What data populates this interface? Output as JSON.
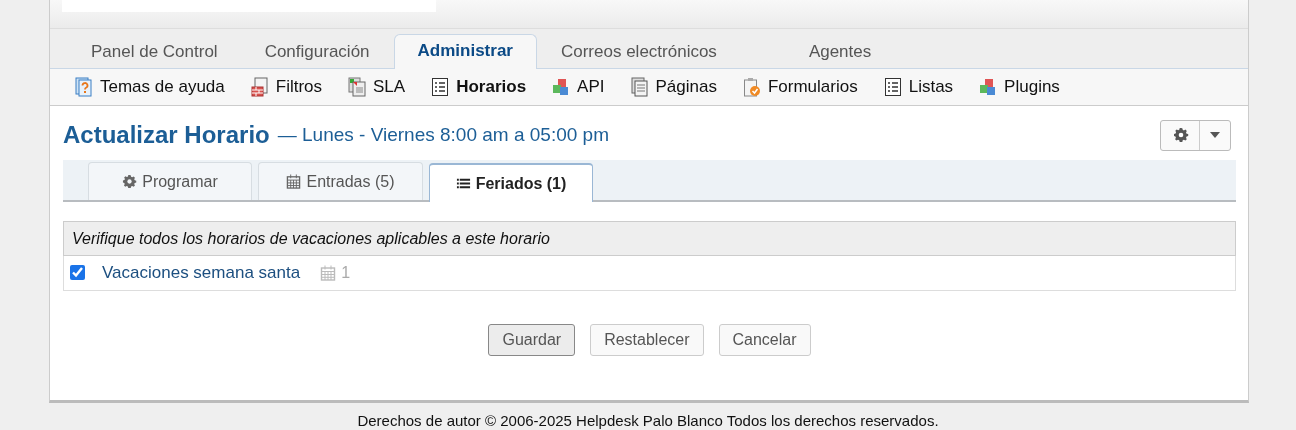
{
  "nav_tabs": [
    {
      "label": "Panel de Control",
      "selected": false
    },
    {
      "label": "Configuración",
      "selected": false
    },
    {
      "label": "Administrar",
      "selected": true
    },
    {
      "label": "Correos electrónicos",
      "selected": false
    },
    {
      "label": "Agentes",
      "selected": false
    }
  ],
  "subnav": [
    {
      "label": "Temas de ayuda",
      "kind": "help",
      "selected": false
    },
    {
      "label": "Filtros",
      "kind": "filter",
      "selected": false
    },
    {
      "label": "SLA",
      "kind": "sla",
      "selected": false
    },
    {
      "label": "Horarios",
      "kind": "list",
      "selected": true
    },
    {
      "label": "API",
      "kind": "cubes",
      "selected": false
    },
    {
      "label": "Páginas",
      "kind": "page",
      "selected": false
    },
    {
      "label": "Formularios",
      "kind": "form",
      "selected": false
    },
    {
      "label": "Listas",
      "kind": "list",
      "selected": false
    },
    {
      "label": "Plugins",
      "kind": "cubes",
      "selected": false
    }
  ],
  "heading": {
    "title": "Actualizar Horario",
    "subtitle": "— Lunes - Viernes 8:00 am a 05:00 pm"
  },
  "tabs": [
    {
      "label": "Programar",
      "kind": "gear",
      "selected": false
    },
    {
      "label": "Entradas (5)",
      "kind": "calendar",
      "selected": false
    },
    {
      "label": "Feriados (1)",
      "kind": "list",
      "selected": true
    }
  ],
  "table": {
    "header": "Verifique todos los horarios de vacaciones aplicables a este horario",
    "rows": [
      {
        "name": "Vacaciones semana santa",
        "checked": true,
        "count": "1"
      }
    ]
  },
  "buttons": [
    {
      "label": "Guardar",
      "kind": "primary"
    },
    {
      "label": "Restablecer",
      "kind": "default"
    },
    {
      "label": "Cancelar",
      "kind": "default"
    }
  ],
  "footer": "Derechos de autor © 2006-2025 Helpdesk Palo Blanco Todos los derechos reservados."
}
